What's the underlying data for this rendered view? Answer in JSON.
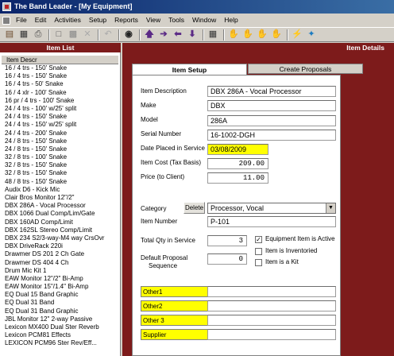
{
  "window": {
    "title": "The Band Leader - [My Equipment]"
  },
  "menu": [
    "File",
    "Edit",
    "Activities",
    "Setup",
    "Reports",
    "View",
    "Tools",
    "Window",
    "Help"
  ],
  "panels": {
    "item_list": "Item List",
    "item_details": "Item Details"
  },
  "item_list": {
    "column_header": "Item Descr",
    "items": [
      "16 / 4 trs - 150' Snake",
      "16 / 4 trs - 150' Snake",
      "16 / 4 trs - 50' Snake",
      "16 / 4 xlr - 100' Snake",
      "16 pr / 4 trs - 100' Snake",
      "24 / 4 trs - 100' w/25' split",
      "24 / 4 trs - 150' Snake",
      "24 / 4 trs - 150' w/25' split",
      "24 / 4 trs - 200' Snake",
      "24 / 8 trs - 150' Snake",
      "24 / 8 trs - 150' Snake",
      "32 / 8 trs - 100' Snake",
      "32 / 8 trs - 150' Snake",
      "32 / 8 trs - 150' Snake",
      "48 / 8 trs - 150' Snake",
      "Audix D6 - Kick Mic",
      "Clair Bros Monitor 12\"/2\"",
      "DBX 286A - Vocal Processor",
      "DBX 1066 Dual Comp/Lim/Gate",
      "DBX 160AD Comp/Limit",
      "DBX 162SL Stereo Comp/Limit",
      "DBX 234 S2/3-way-M4 way CrsOvr",
      "DBX DriveRack 220i",
      "Drawmer DS 201 2 Ch Gate",
      "Drawmer DS 404 4 Ch",
      "Drum Mic Kit 1",
      "EAW Monitor 12\"/2\" Bi-Amp",
      "EAW Monitor 15\"/1.4\" Bi-Amp",
      "EQ Dual 15 Band Graphic",
      "EQ Dual 31 Band",
      "EQ Dual 31 Band Graphic",
      "JBL Monitor 12\" 2-way Passive",
      "Lexicon MX400 Dual Ster Reverb",
      "Lexicon PCM81 Effects",
      "LEXICON PCM96 Ster Rev/Eff..."
    ]
  },
  "tabs": {
    "item_setup": "Item Setup",
    "create_proposals": "Create Proposals"
  },
  "form": {
    "description_label": "Item Description",
    "description_value": "DBX 286A - Vocal Processor",
    "make_label": "Make",
    "make_value": "DBX",
    "model_label": "Model",
    "model_value": "286A",
    "serial_label": "Serial Number",
    "serial_value": "16-1002-DGH",
    "date_label": "Date Placed in Service",
    "date_value": "03/08/2009",
    "cost_label": "Item Cost (Tax Basis)",
    "cost_value": "209.00",
    "price_label": "Price (to Client)",
    "price_value": "11.00",
    "category_label": "Category",
    "delete_label": "Delete",
    "category_value": "Processor, Vocal",
    "item_number_label": "Item Number",
    "item_number_value": "P-101",
    "qty_label": "Total Qty in Service",
    "qty_value": "3",
    "seq_label_1": "Default Proposal",
    "seq_label_2": "Sequence",
    "seq_value": "0",
    "active_label": "Equipment Item is Active",
    "inventoried_label": "Item is Inventoried",
    "kit_label": "Item is a Kit",
    "active_checked": true,
    "inventoried_checked": false,
    "kit_checked": false,
    "other1_label": "Other1",
    "other2_label": "Other2",
    "other3_label": "Other 3",
    "supplier_label": "Supplier"
  },
  "colors": {
    "panel_header": "#7d1b1b",
    "highlight": "#ffff00"
  },
  "toolbar_icons": [
    "doorway-icon",
    "calendar-icon",
    "print-icon",
    "new-doc-icon",
    "save-icon",
    "delete-icon",
    "undo-icon",
    "binoculars-icon",
    "arrow-up-icon",
    "arrow-right-icon",
    "arrow-left-icon",
    "arrow-down-icon",
    "grid-icon",
    "hand-icon",
    "hand-icon",
    "hand-icon",
    "hand-icon",
    "wand-icon",
    "pin-icon"
  ]
}
